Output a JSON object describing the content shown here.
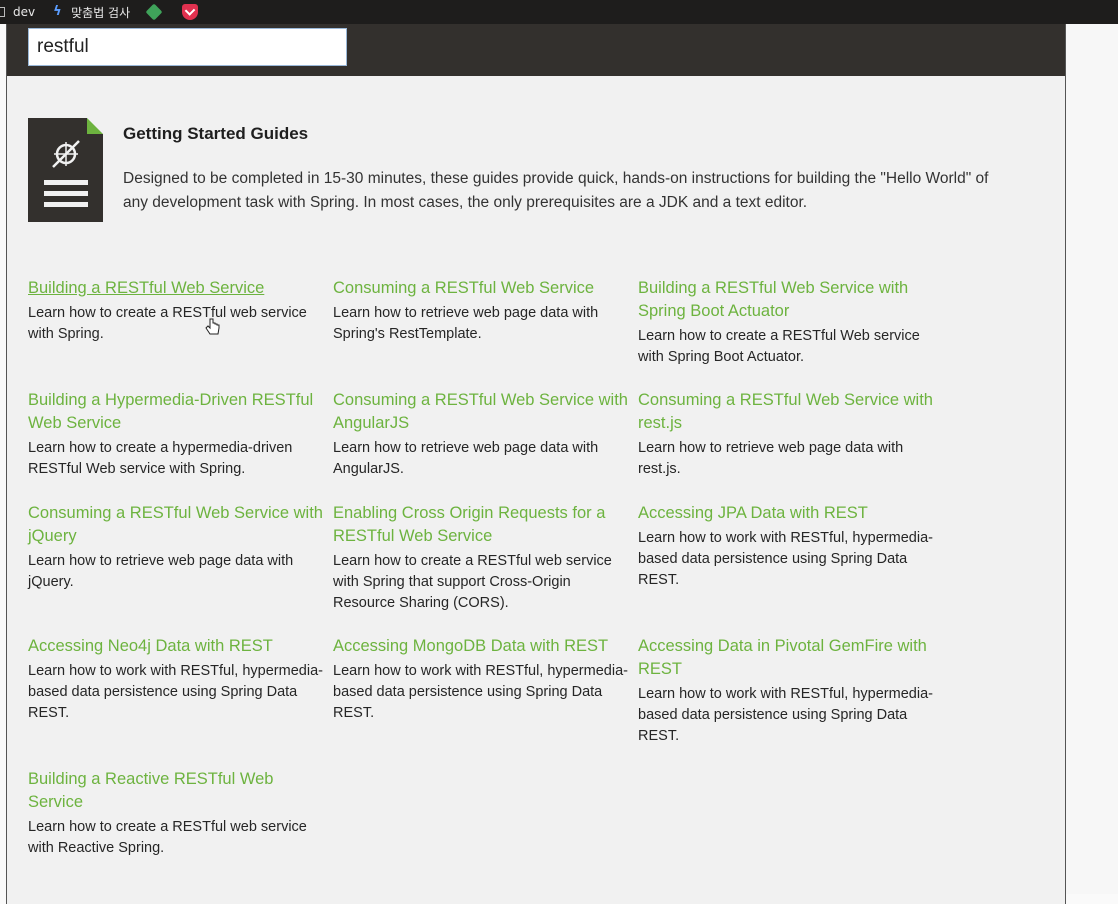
{
  "bookmarks": [
    {
      "label": "dev",
      "icon": "folder-icon"
    },
    {
      "label": "맞춤법 검사",
      "icon": "spell-check-icon"
    },
    {
      "label": "",
      "icon": "diamond-extension-icon"
    },
    {
      "label": "",
      "icon": "pocket-icon"
    }
  ],
  "search": {
    "value": "restful"
  },
  "intro": {
    "title": "Getting Started Guides",
    "text": "Designed to be completed in 15-30 minutes, these guides provide quick, hands-on instructions for building the \"Hello World\" of any development task with Spring. In most cases, the only prerequisites are a JDK and a text editor."
  },
  "colors": {
    "accent": "#6db33f",
    "header": "#33302d"
  },
  "guides": [
    {
      "title": "Building a RESTful Web Service",
      "desc": "Learn how to create a RESTful web service with Spring."
    },
    {
      "title": "Consuming a RESTful Web Service",
      "desc": "Learn how to retrieve web page data with Spring's RestTemplate."
    },
    {
      "title": "Building a RESTful Web Service with Spring Boot Actuator",
      "desc": "Learn how to create a RESTful Web service with Spring Boot Actuator."
    },
    {
      "title": "Building a Hypermedia-Driven RESTful Web Service",
      "desc": "Learn how to create a hypermedia-driven RESTful Web service with Spring."
    },
    {
      "title": "Consuming a RESTful Web Service with AngularJS",
      "desc": "Learn how to retrieve web page data with AngularJS."
    },
    {
      "title": "Consuming a RESTful Web Service with rest.js",
      "desc": "Learn how to retrieve web page data with rest.js."
    },
    {
      "title": "Consuming a RESTful Web Service with jQuery",
      "desc": "Learn how to retrieve web page data with jQuery."
    },
    {
      "title": "Enabling Cross Origin Requests for a RESTful Web Service",
      "desc": "Learn how to create a RESTful web service with Spring that support Cross-Origin Resource Sharing (CORS)."
    },
    {
      "title": "Accessing JPA Data with REST",
      "desc": "Learn how to work with RESTful, hypermedia-based data persistence using Spring Data REST."
    },
    {
      "title": "Accessing Neo4j Data with REST",
      "desc": "Learn how to work with RESTful, hypermedia-based data persistence using Spring Data REST."
    },
    {
      "title": "Accessing MongoDB Data with REST",
      "desc": "Learn how to work with RESTful, hypermedia-based data persistence using Spring Data REST."
    },
    {
      "title": "Accessing Data in Pivotal GemFire with REST",
      "desc": "Learn how to work with RESTful, hypermedia-based data persistence using Spring Data REST."
    },
    {
      "title": "Building a Reactive RESTful Web Service",
      "desc": "Learn how to create a RESTful web service with Reactive Spring."
    }
  ]
}
